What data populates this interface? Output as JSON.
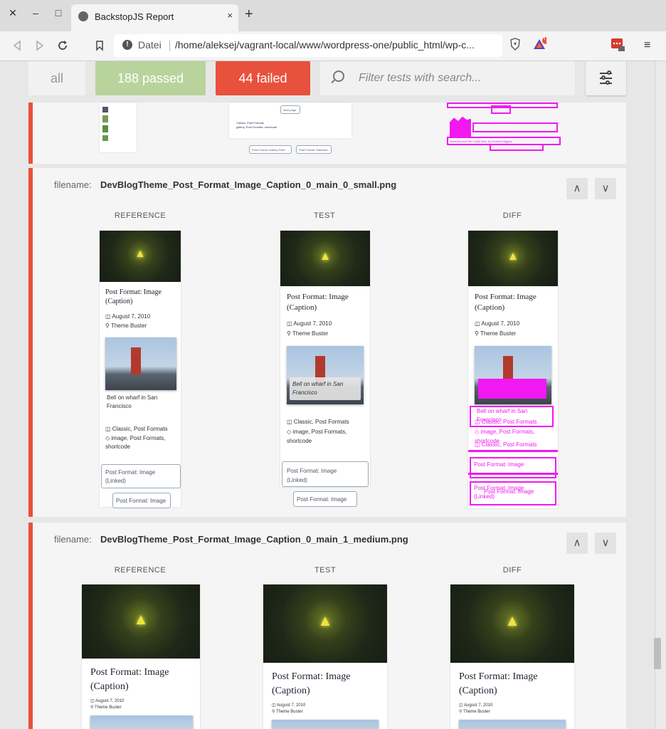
{
  "browser": {
    "tab_title": "BackstopJS Report",
    "tab_close": "×",
    "new_tab": "+",
    "window_close": "✕",
    "window_min": "–",
    "window_max": "□",
    "url_scheme": "Datei",
    "url": "/home/aleksej/vagrant-local/www/wordpress-one/public_html/wp-c...",
    "ext_badge_count": "8",
    "brave_badge": "!"
  },
  "filters": {
    "all_label": "all",
    "passed_label": "188 passed",
    "failed_label": "44 failed",
    "search_placeholder": "Filter tests with search..."
  },
  "colors": {
    "failed_accent": "#e8513c",
    "passed_accent": "#b9d39c",
    "diff_magenta": "#f218f2"
  },
  "prev_card": {
    "ref_btn_text": "Post Format: Gallery Filed",
    "ref_btn2_text": "Post Format: Standard",
    "test_btn_text": "Next page",
    "test_meta_1": "Classic, Post Formats",
    "test_meta_2": "gallery, Post Formats, shortcode",
    "diff_caption_1": "Sunburst over the Chain Bow, by Howard Higgins"
  },
  "cards": [
    {
      "filename_label": "filename:",
      "filename": "DevBlogTheme_Post_Format_Image_Caption_0_main_0_small.png",
      "up_label": "∧",
      "down_label": "∨",
      "col_reference": "REFERENCE",
      "col_test": "TEST",
      "col_diff": "DIFF",
      "post": {
        "title_line1": "Post Format: Image",
        "title_line2": "(Caption)",
        "date": "August 7, 2010",
        "author": "Theme Buster",
        "caption_line1": "Bell on wharf in San",
        "caption_line2": "Francisco",
        "cats": "Classic, Post Formats",
        "tags_line1": "image, Post Formats,",
        "tags_line2": "shortcode",
        "btn_prev_line1": "Post Format: Image",
        "btn_prev_line2": "(Linked)",
        "btn_next": "Post Format: Image"
      }
    },
    {
      "filename_label": "filename:",
      "filename": "DevBlogTheme_Post_Format_Image_Caption_0_main_1_medium.png",
      "up_label": "∧",
      "down_label": "∨",
      "col_reference": "REFERENCE",
      "col_test": "TEST",
      "col_diff": "DIFF",
      "post": {
        "title_line1": "Post Format: Image",
        "title_line2": "(Caption)",
        "date": "August 7, 2010",
        "author": "Theme Buster"
      }
    }
  ]
}
